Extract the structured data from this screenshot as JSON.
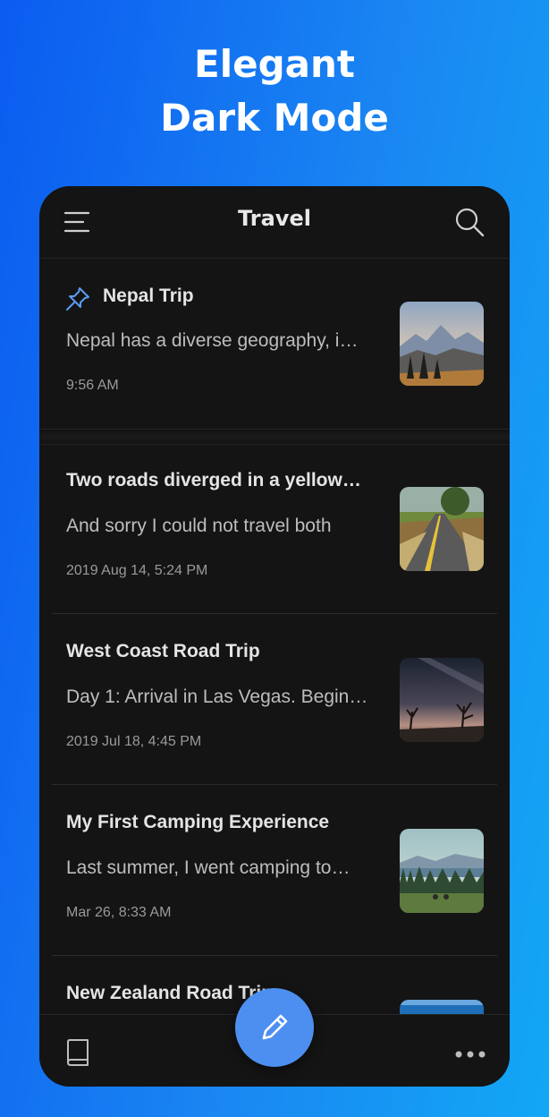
{
  "headline": {
    "line1": "Elegant",
    "line2": "Dark Mode"
  },
  "header": {
    "title": "Travel",
    "menu_icon": "menu-icon",
    "search_icon": "search-icon"
  },
  "pinned_note": {
    "title": "Nepal Trip",
    "preview": "Nepal has a diverse geography, i…",
    "time": "9:56 AM",
    "pin_icon": "pin-icon",
    "thumbnail": "mountain-sunset-photo"
  },
  "notes": [
    {
      "title": "Two roads diverged in a yellow…",
      "preview": "And sorry I could not travel both",
      "time": "2019 Aug 14, 5:24 PM",
      "thumbnail": "country-road-photo"
    },
    {
      "title": "West Coast Road Trip",
      "preview": "Day 1: Arrival in Las Vegas. Begin…",
      "time": "2019 Jul 18, 4:45 PM",
      "thumbnail": "desert-night-sky-photo"
    },
    {
      "title": "My First Camping Experience",
      "preview": "Last summer, I went camping to…",
      "time": "Mar 26, 8:33 AM",
      "thumbnail": "forest-lake-photo"
    },
    {
      "title": "New Zealand Road Trip",
      "preview": "",
      "time": "",
      "thumbnail": "blue-sky-photo"
    }
  ],
  "bottom_bar": {
    "left_icon": "notebook-icon",
    "right_icon": "more-icon",
    "fab_icon": "pencil-icon"
  },
  "colors": {
    "accent": "#4d8ff0",
    "background": "#141414",
    "gradient_start": "#0b5cf0",
    "gradient_end": "#12a7f5"
  }
}
